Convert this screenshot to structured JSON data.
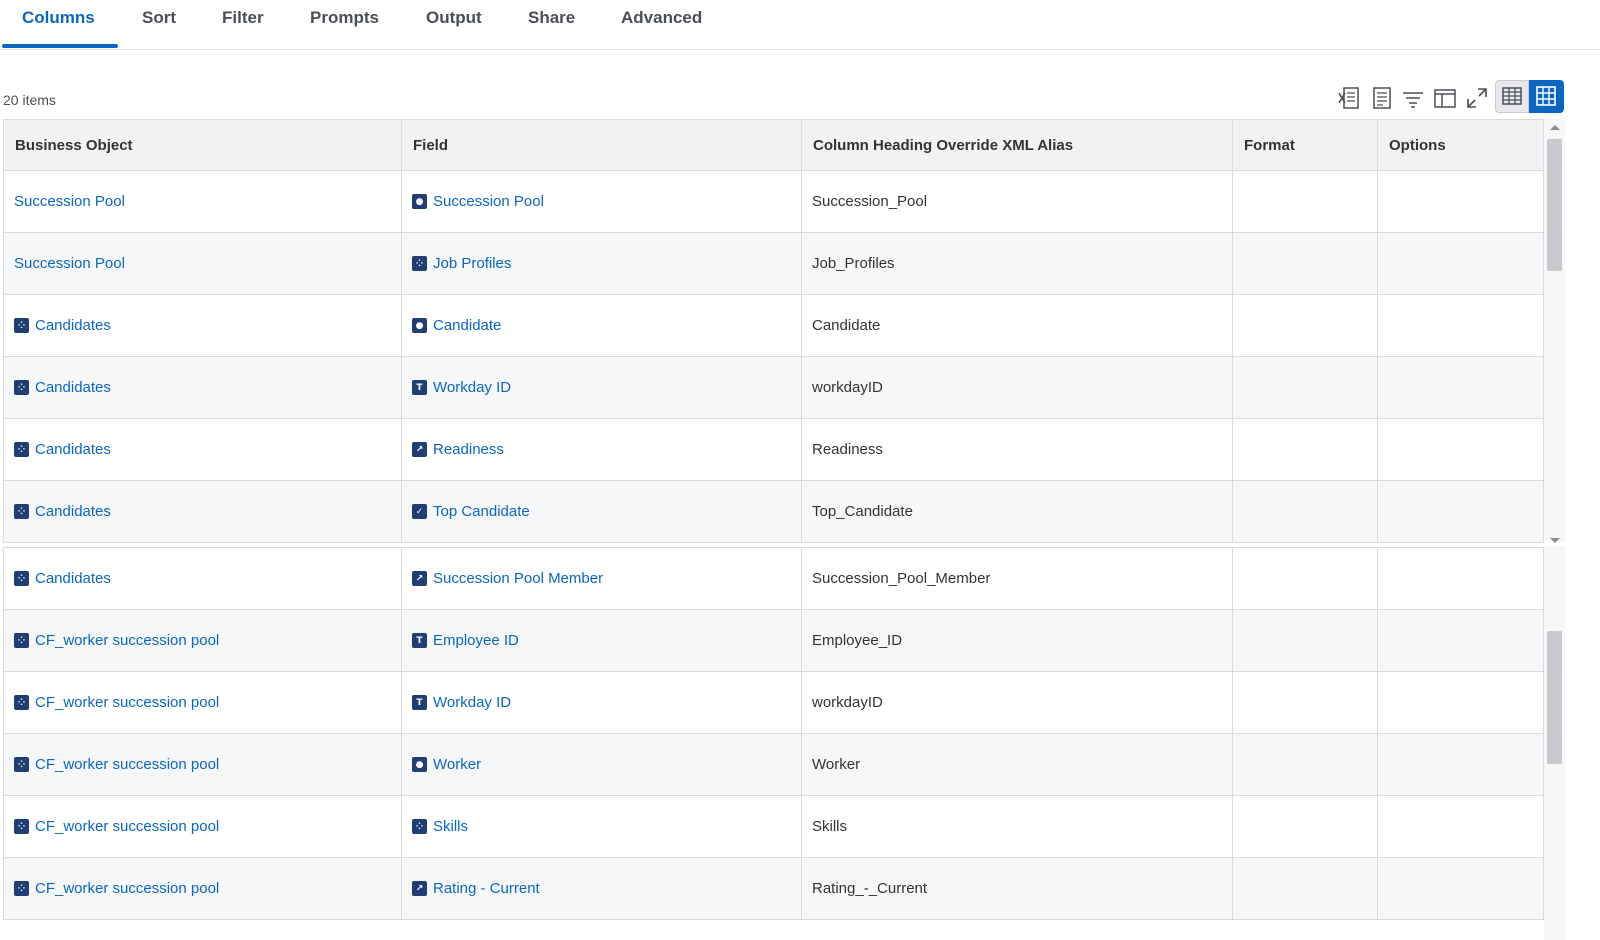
{
  "tabs": [
    "Columns",
    "Sort",
    "Filter",
    "Prompts",
    "Output",
    "Share",
    "Advanced"
  ],
  "item_count": "20 items",
  "toolbar_icons": [
    "excel-export-icon",
    "pdf-export-icon",
    "filter-icon",
    "column-layout-icon",
    "fullscreen-icon",
    "table-view-icon",
    "grid-view-icon"
  ],
  "columns": [
    "Business Object",
    "Field",
    "Column Heading Override XML Alias",
    "Format",
    "Options"
  ],
  "rows_top": [
    {
      "bo": "Succession Pool",
      "bo_icon": "",
      "field": "Succession Pool",
      "field_icon": "instance-icon",
      "alias": "Succession_Pool"
    },
    {
      "bo": "Succession Pool",
      "bo_icon": "",
      "field": "Job Profiles",
      "field_icon": "multi-instance-icon",
      "alias": "Job_Profiles"
    },
    {
      "bo": "Candidates",
      "bo_icon": "multi-instance-icon",
      "field": "Candidate",
      "field_icon": "instance-icon",
      "alias": "Candidate"
    },
    {
      "bo": "Candidates",
      "bo_icon": "multi-instance-icon",
      "field": "Workday ID",
      "field_icon": "text-icon",
      "alias": "workdayID"
    },
    {
      "bo": "Candidates",
      "bo_icon": "multi-instance-icon",
      "field": "Readiness",
      "field_icon": "single-instance-icon",
      "alias": "Readiness"
    },
    {
      "bo": "Candidates",
      "bo_icon": "multi-instance-icon",
      "field": "Top Candidate",
      "field_icon": "boolean-icon",
      "alias": "Top_Candidate"
    }
  ],
  "rows_bottom": [
    {
      "bo": "Candidates",
      "bo_icon": "multi-instance-icon",
      "field": "Succession Pool Member",
      "field_icon": "single-instance-icon",
      "alias": "Succession_Pool_Member"
    },
    {
      "bo": "CF_worker succession pool",
      "bo_icon": "multi-instance-icon",
      "field": "Employee ID",
      "field_icon": "text-icon",
      "alias": "Employee_ID"
    },
    {
      "bo": "CF_worker succession pool",
      "bo_icon": "multi-instance-icon",
      "field": "Workday ID",
      "field_icon": "text-icon",
      "alias": "workdayID"
    },
    {
      "bo": "CF_worker succession pool",
      "bo_icon": "multi-instance-icon",
      "field": "Worker",
      "field_icon": "instance-icon",
      "alias": "Worker"
    },
    {
      "bo": "CF_worker succession pool",
      "bo_icon": "multi-instance-icon",
      "field": "Skills",
      "field_icon": "multi-instance-icon",
      "alias": "Skills"
    },
    {
      "bo": "CF_worker succession pool",
      "bo_icon": "multi-instance-icon",
      "field": "Rating - Current",
      "field_icon": "single-instance-icon",
      "alias": "Rating_-_Current"
    }
  ],
  "colors": {
    "accent": "#0b66c3",
    "icon_bg": "#1f3e73",
    "header_bg": "#f1f2f4"
  }
}
